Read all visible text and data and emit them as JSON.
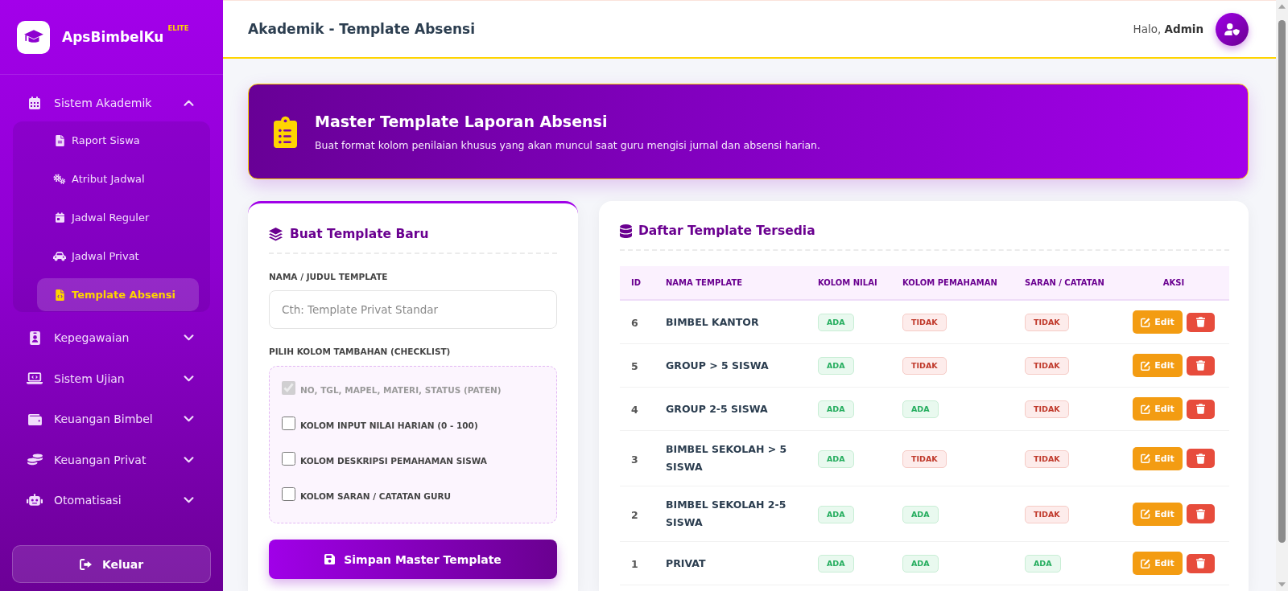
{
  "sidebar": {
    "brand": {
      "name": "ApsBimbelKu",
      "badge": "ELITE"
    },
    "menu": [
      {
        "label": "Sistem Akademik",
        "expanded": true,
        "children": [
          {
            "label": "Raport Siswa",
            "selected": false
          },
          {
            "label": "Atribut Jadwal",
            "selected": false
          },
          {
            "label": "Jadwal Reguler",
            "selected": false
          },
          {
            "label": "Jadwal Privat",
            "selected": false
          },
          {
            "label": "Template Absensi",
            "selected": true
          }
        ]
      },
      {
        "label": "Kepegawaian",
        "expanded": false
      },
      {
        "label": "Sistem Ujian",
        "expanded": false
      },
      {
        "label": "Keuangan Bimbel",
        "expanded": false
      },
      {
        "label": "Keuangan Privat",
        "expanded": false
      },
      {
        "label": "Otomatisasi",
        "expanded": false
      }
    ],
    "logout": {
      "label": "Keluar"
    }
  },
  "header": {
    "title": "Akademik - Template Absensi",
    "greeting": "Halo, **Admin**"
  },
  "banner": {
    "title": "Master Template Laporan Absensi",
    "subtitle": "Buat format kolom penilaian khusus yang akan muncul saat guru mengisi jurnal dan absensi harian."
  },
  "form": {
    "title": "Buat Template Baru",
    "name_label": "NAMA / JUDUL TEMPLATE",
    "name_field": {
      "placeholder": "Cth: Template Privat Standar"
    },
    "options_label": "PILIH KOLOM TAMBAHAN (CHECKLIST)",
    "options": [
      {
        "label": "NO, TGL, MAPEL, MATERI, STATUS (PATEN)",
        "checked": true,
        "disabled": true
      },
      {
        "label": "KOLOM INPUT NILAI HARIAN (0 - 100)",
        "checked": false,
        "disabled": false
      },
      {
        "label": "KOLOM DESKRIPSI PEMAHAMAN SISWA",
        "checked": false,
        "disabled": false
      },
      {
        "label": "KOLOM SARAN / CATATAN GURU",
        "checked": false,
        "disabled": false
      }
    ],
    "submit": "Simpan Master Template"
  },
  "templates": {
    "title": "Daftar Template Tersedia",
    "columns": [
      "ID",
      "NAMA TEMPLATE",
      "KOLOM NILAI",
      "KOLOM PEMAHAMAN",
      "SARAN / CATATAN",
      "AKSI"
    ],
    "rows": [
      {
        "id": "6",
        "name": "BIMBEL KANTOR",
        "flags": [
          {
            "text": "ADA",
            "on": true
          },
          {
            "text": "TIDAK",
            "on": false
          },
          {
            "text": "TIDAK",
            "on": false
          }
        ],
        "edit": "Edit"
      },
      {
        "id": "5",
        "name": "GROUP > 5 SISWA",
        "flags": [
          {
            "text": "ADA",
            "on": true
          },
          {
            "text": "TIDAK",
            "on": false
          },
          {
            "text": "TIDAK",
            "on": false
          }
        ],
        "edit": "Edit"
      },
      {
        "id": "4",
        "name": "GROUP 2-5 SISWA",
        "flags": [
          {
            "text": "ADA",
            "on": true
          },
          {
            "text": "ADA",
            "on": true
          },
          {
            "text": "TIDAK",
            "on": false
          }
        ],
        "edit": "Edit"
      },
      {
        "id": "3",
        "name": "BIMBEL SEKOLAH > 5 SISWA",
        "flags": [
          {
            "text": "ADA",
            "on": true
          },
          {
            "text": "TIDAK",
            "on": false
          },
          {
            "text": "TIDAK",
            "on": false
          }
        ],
        "edit": "Edit"
      },
      {
        "id": "2",
        "name": "BIMBEL SEKOLAH 2-5 SISWA",
        "flags": [
          {
            "text": "ADA",
            "on": true
          },
          {
            "text": "ADA",
            "on": true
          },
          {
            "text": "TIDAK",
            "on": false
          }
        ],
        "edit": "Edit"
      },
      {
        "id": "1",
        "name": "PRIVAT",
        "flags": [
          {
            "text": "ADA",
            "on": true
          },
          {
            "text": "ADA",
            "on": true
          },
          {
            "text": "ADA",
            "on": true
          }
        ],
        "edit": "Edit"
      }
    ]
  }
}
